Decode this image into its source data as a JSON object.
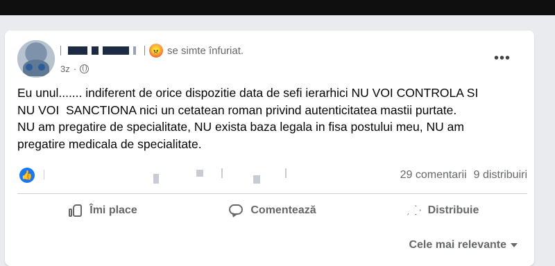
{
  "post": {
    "feeling_text": "se simte înfuriat.",
    "time": "3z",
    "text": "Eu unul....... indiferent de orice dispozitie data de sefi ierarhici NU VOI CONTROLA SI\nNU VOI  SANCTIONA nici un cetatean roman privind autenticitatea mastii purtate.\nNU am pregatire de specialitate, NU exista baza legala in fisa postului meu, NU am\npregatire medicala de specialitate.",
    "more_label": "•••",
    "comments_count": "29 comentarii",
    "shares_count": "9 distribuiri"
  },
  "actions": {
    "like_label": "Îmi place",
    "comment_label": "Comentează",
    "share_label": "Distribuie"
  },
  "sort": {
    "label": "Cele mai relevante"
  },
  "icons": {
    "reaction": "angry-face-icon",
    "privacy": "globe-icon",
    "like": "thumbs-up-icon",
    "comment": "comment-bubble-icon",
    "share": "share-arrow-icon"
  },
  "colors": {
    "like_blue": "#1877f2",
    "muted_text": "#65676b",
    "body_text": "#050505"
  }
}
